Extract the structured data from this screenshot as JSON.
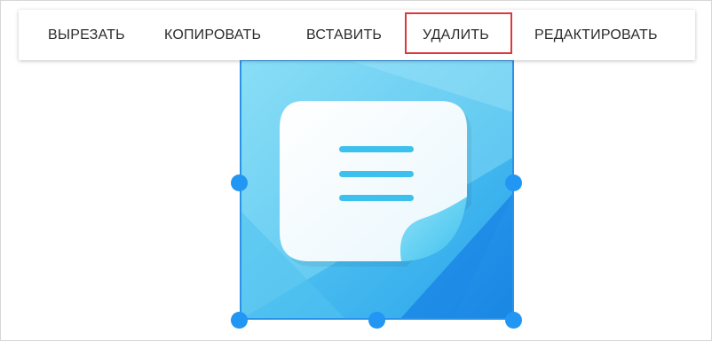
{
  "context_menu": {
    "items": [
      {
        "label": "ВЫРЕЗАТЬ"
      },
      {
        "label": "КОПИРОВАТЬ"
      },
      {
        "label": "ВСТАВИТЬ"
      },
      {
        "label": "УДАЛИТЬ",
        "highlighted": true
      },
      {
        "label": "РЕДАКТИРОВАТЬ"
      }
    ],
    "highlight_color": "#d93a3f"
  },
  "selected_image": {
    "icon": "notes-document-icon",
    "colors": {
      "background_light": "#7fdaf5",
      "background_mid": "#3fb8ee",
      "background_dark": "#1e8ee8",
      "page": "#f4fbfe",
      "lines": "#3cc1ee",
      "fold": "#6ad2f3"
    }
  },
  "selection": {
    "border_color": "#2a93e8",
    "handle_color": "#2196f3",
    "handles": [
      "middle-left",
      "middle-right",
      "bottom-left",
      "bottom-middle",
      "bottom-right"
    ]
  }
}
